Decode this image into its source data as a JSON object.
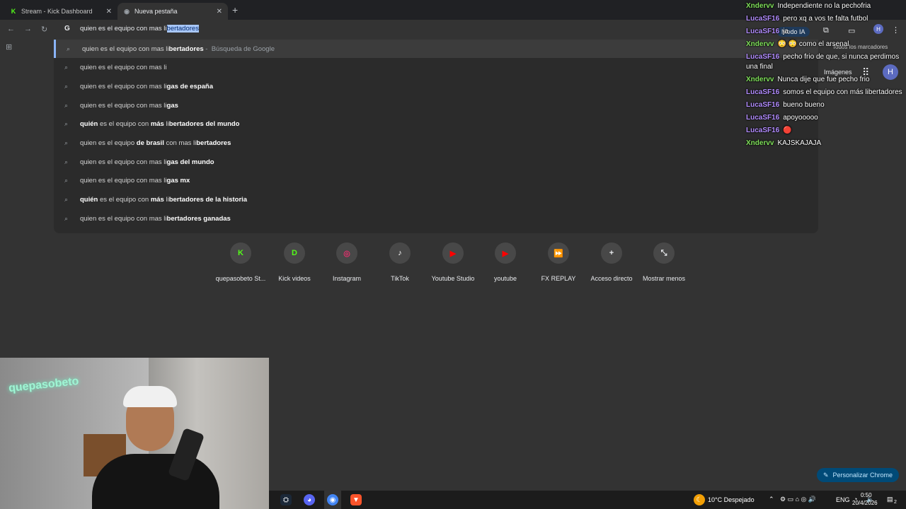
{
  "tabs": [
    {
      "title": "Stream - Kick Dashboard",
      "favicon": "kick-icon"
    },
    {
      "title": "Nueva pestaña",
      "favicon": "chrome-icon"
    }
  ],
  "omnibox": {
    "typed": "quien es el equipo con mas li",
    "autocomplete": "bertadores"
  },
  "suggestions": [
    {
      "parts": [
        [
          "n",
          "quien es el equipo con mas li"
        ],
        [
          "b",
          "bertadores"
        ]
      ],
      "sub": " -  Búsqueda de Google"
    },
    {
      "parts": [
        [
          "n",
          "quien es el equipo con mas li"
        ]
      ],
      "sub": ""
    },
    {
      "parts": [
        [
          "n",
          "quien es el equipo con mas li"
        ],
        [
          "b",
          "gas de españa"
        ]
      ],
      "sub": ""
    },
    {
      "parts": [
        [
          "n",
          "quien es el equipo con mas li"
        ],
        [
          "b",
          "gas"
        ]
      ],
      "sub": ""
    },
    {
      "parts": [
        [
          "b",
          "quién"
        ],
        [
          "n",
          " es el equipo con "
        ],
        [
          "b",
          "más"
        ],
        [
          "n",
          " li"
        ],
        [
          "b",
          "bertadores del mundo"
        ]
      ],
      "sub": ""
    },
    {
      "parts": [
        [
          "n",
          "quien es el equipo "
        ],
        [
          "b",
          "de brasil"
        ],
        [
          "n",
          " con mas li"
        ],
        [
          "b",
          "bertadores"
        ]
      ],
      "sub": ""
    },
    {
      "parts": [
        [
          "n",
          "quien es el equipo con mas li"
        ],
        [
          "b",
          "gas del mundo"
        ]
      ],
      "sub": ""
    },
    {
      "parts": [
        [
          "n",
          "quien es el equipo con mas li"
        ],
        [
          "b",
          "gas mx"
        ]
      ],
      "sub": ""
    },
    {
      "parts": [
        [
          "b",
          "quién"
        ],
        [
          "n",
          " es el equipo con "
        ],
        [
          "b",
          "más"
        ],
        [
          "n",
          " li"
        ],
        [
          "b",
          "bertadores de la historia"
        ]
      ],
      "sub": ""
    },
    {
      "parts": [
        [
          "n",
          "quien es el equipo con mas li"
        ],
        [
          "b",
          "bertadores ganadas"
        ]
      ],
      "sub": ""
    }
  ],
  "shortcuts": [
    {
      "label": "quepasobeto St...",
      "glyph": "K",
      "color": "#53fc18",
      "icon": "kick-icon"
    },
    {
      "label": "Kick videos",
      "glyph": "D",
      "color": "#53fc18",
      "icon": "kick-videos-icon"
    },
    {
      "label": "Instagram",
      "glyph": "◎",
      "color": "#e1306c",
      "icon": "instagram-icon"
    },
    {
      "label": "TikTok",
      "glyph": "♪",
      "color": "#ffffff",
      "icon": "tiktok-icon"
    },
    {
      "label": "Youtube Studio",
      "glyph": "▶",
      "color": "#ff0000",
      "icon": "youtube-studio-icon"
    },
    {
      "label": "youtube",
      "glyph": "▶",
      "color": "#ff0000",
      "icon": "youtube-icon"
    },
    {
      "label": "FX REPLAY",
      "glyph": "⏩",
      "color": "#ffffff",
      "icon": "fx-replay-icon"
    },
    {
      "label": "Acceso directo",
      "glyph": "+",
      "color": "#e8eaed",
      "icon": "plus-icon"
    },
    {
      "label": "Mostrar menos",
      "glyph": "⤡",
      "color": "#e8eaed",
      "icon": "collapse-icon"
    }
  ],
  "ntp": {
    "ai_mode": "Modo IA",
    "bookmarks": "Todos los marcadores",
    "images": "Imágenes",
    "profile_initial": "H"
  },
  "chat": [
    {
      "user": "Xndervv",
      "color": "#7fe05a",
      "text": "Independiente no la pechofria"
    },
    {
      "user": "LucaSF16",
      "color": "#b28cff",
      "text": "pero xq a vos te falta futbol"
    },
    {
      "user": "LucaSF16",
      "color": "#b28cff",
      "text": "ja"
    },
    {
      "user": "Xndervv",
      "color": "#7fe05a",
      "text": "😳 😳 como el arsenal"
    },
    {
      "user": "LucaSF16",
      "color": "#b28cff",
      "text": "pecho frio de que, si nunca perdimos una final"
    },
    {
      "user": "Xndervv",
      "color": "#7fe05a",
      "text": "Nunca dije que fue pecho frio"
    },
    {
      "user": "LucaSF16",
      "color": "#b28cff",
      "text": "somos el equipo con más libertadores"
    },
    {
      "user": "LucaSF16",
      "color": "#b28cff",
      "text": "bueno bueno"
    },
    {
      "user": "LucaSF16",
      "color": "#b28cff",
      "text": "apoyooooo"
    },
    {
      "user": "LucaSF16",
      "color": "#b28cff",
      "text": "🔴"
    },
    {
      "user": "Xndervv",
      "color": "#7fe05a",
      "text": "KAJSKAJAJA"
    }
  ],
  "webcam": {
    "neon_text": "quepasobeto"
  },
  "customize_label": "Personalizar Chrome",
  "taskbar": {
    "weather": "10°C  Despejado",
    "lang": "ENG",
    "time": "0:50",
    "date": "20/4/2026",
    "notif_count": "2"
  }
}
